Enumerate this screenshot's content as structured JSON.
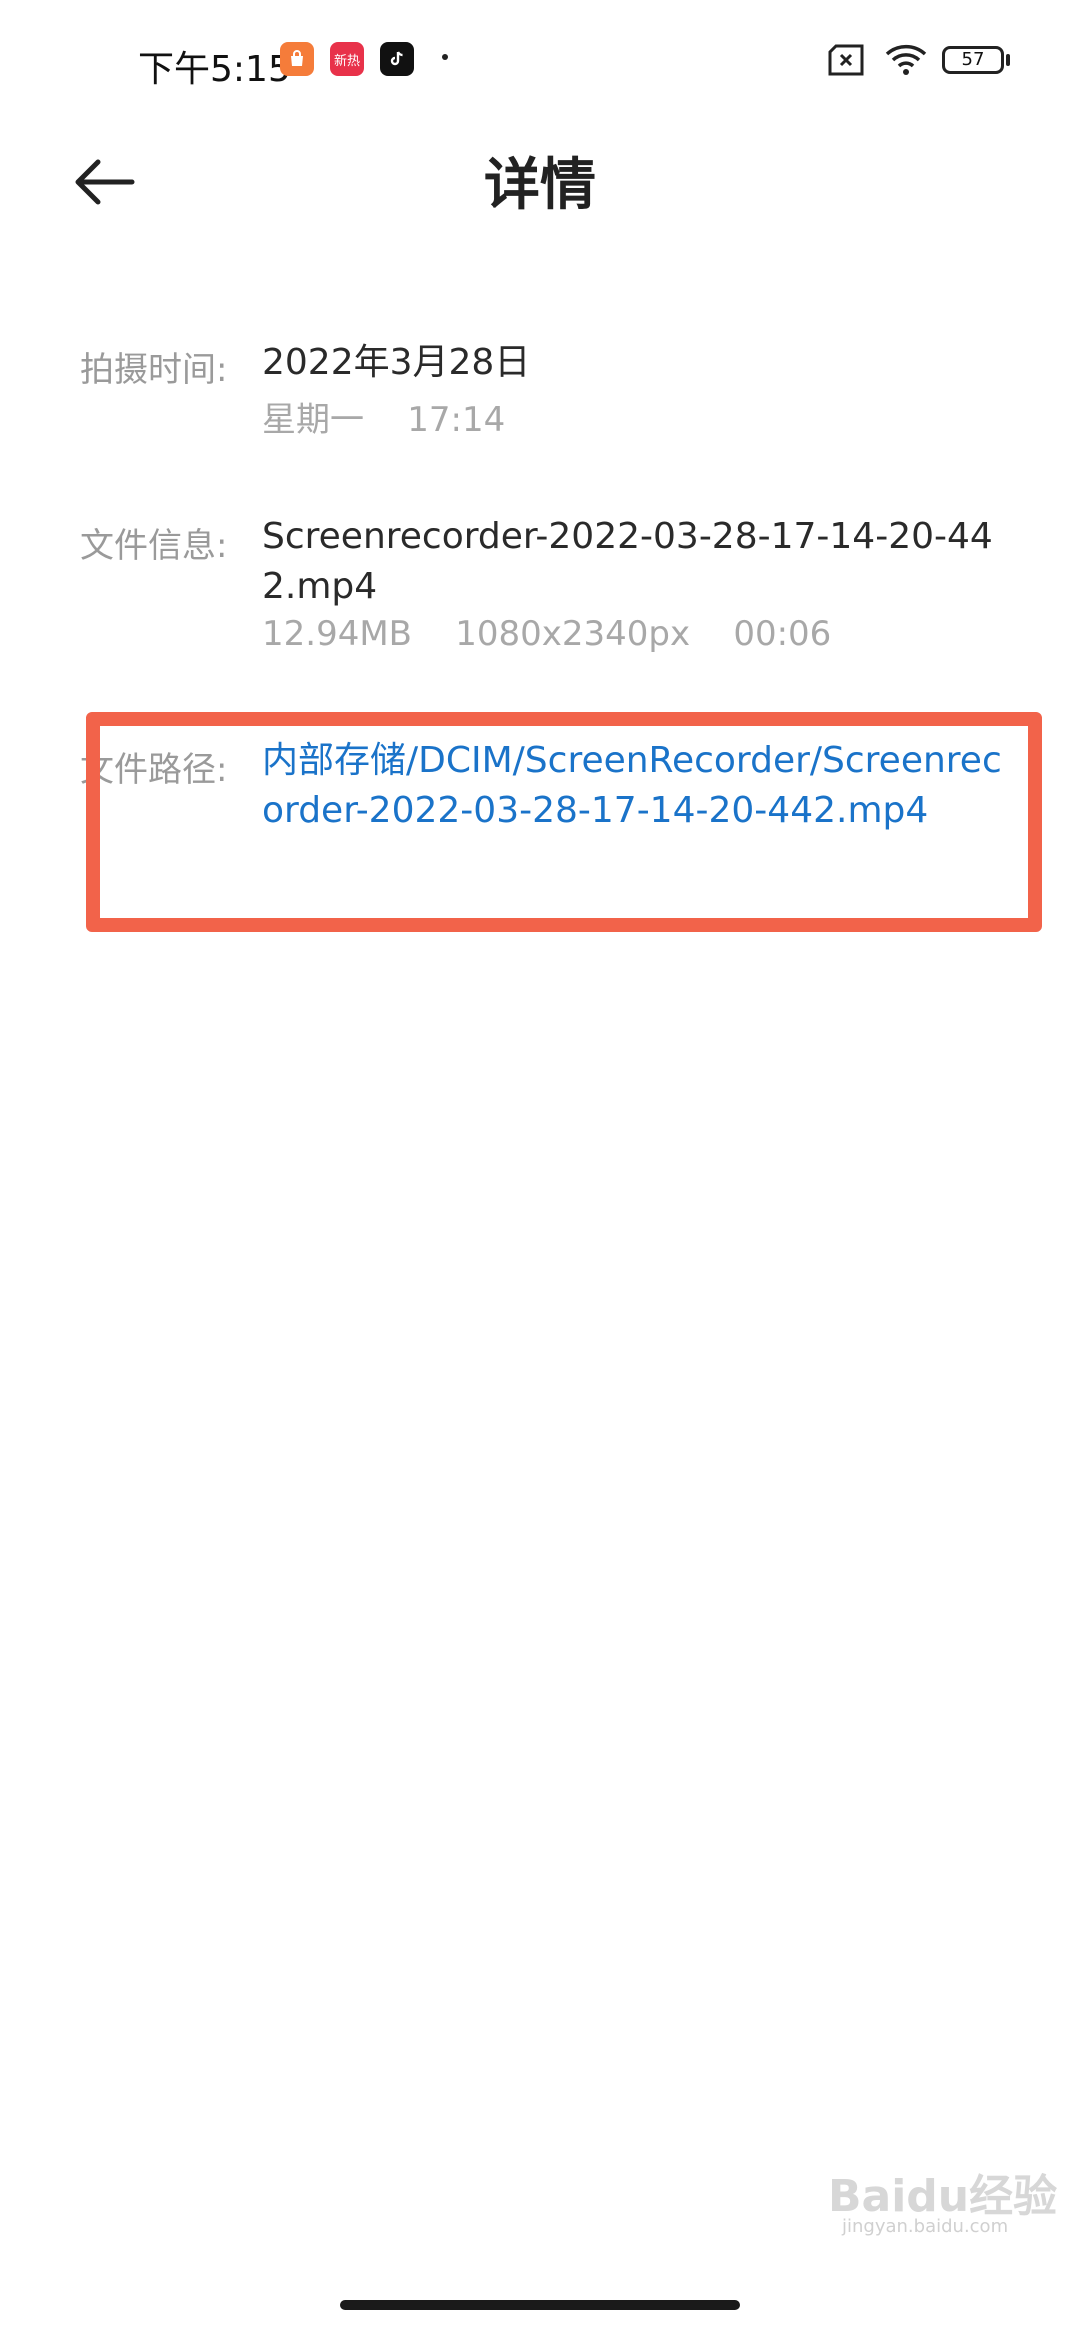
{
  "status_bar": {
    "time": "下午5:15",
    "app_icons": [
      "shopping-bag-icon",
      "news-icon",
      "tiktok-icon"
    ],
    "app2_text": "新热",
    "battery": "57"
  },
  "header": {
    "title": "详情"
  },
  "details": {
    "capture_time": {
      "label": "拍摄时间:",
      "date": "2022年3月28日",
      "weekday_time": "星期一    17:14"
    },
    "file_info": {
      "label": "文件信息:",
      "filename": "Screenrecorder-2022-03-28-17-14-20-442.mp4",
      "meta": "12.94MB    1080x2340px    00:06"
    },
    "file_path": {
      "label": "文件路径:",
      "path": "内部存储/DCIM/ScreenRecorder/Screenrecorder-2022-03-28-17-14-20-442.mp4"
    }
  },
  "watermark": {
    "brand": "Baidu经验",
    "url": "jingyan.baidu.com"
  },
  "colors": {
    "link": "#1a73c9",
    "highlight": "#f2634a"
  }
}
